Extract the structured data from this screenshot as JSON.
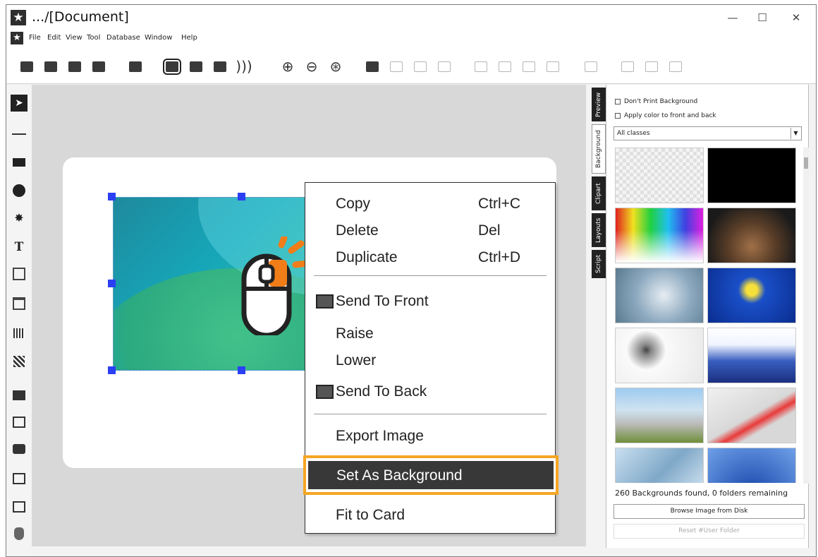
{
  "window": {
    "title": ".../[Document]",
    "minimize": "—",
    "maximize": "☐",
    "close": "✕"
  },
  "menubar": [
    "File",
    "Edit",
    "View",
    "Tool",
    "Database",
    "Window",
    "Help"
  ],
  "context_menu": {
    "copy": {
      "label": "Copy",
      "shortcut": "Ctrl+C"
    },
    "delete": {
      "label": "Delete",
      "shortcut": "Del"
    },
    "duplicate": {
      "label": "Duplicate",
      "shortcut": "Ctrl+D"
    },
    "send_to_front": "Send To Front",
    "raise": "Raise",
    "lower": "Lower",
    "send_to_back": "Send To Back",
    "export_image": "Export Image",
    "set_as_background": "Set As Background",
    "fit_to_card": "Fit to Card"
  },
  "side_tabs": [
    "Preview",
    "Background",
    "Clipart",
    "Layouts",
    "Script"
  ],
  "panel": {
    "dont_print": "Don't Print Background",
    "apply_color": "Apply color to front and back",
    "class_select": "All classes",
    "status": "260 Backgrounds found, 0 folders remaining",
    "browse_button": "Browse Image from Disk",
    "reset_button": "Reset #User Folder"
  },
  "colors": {
    "highlight_border": "#f5a623",
    "handle": "#2b3ff5",
    "menu_selected": "#383838"
  }
}
